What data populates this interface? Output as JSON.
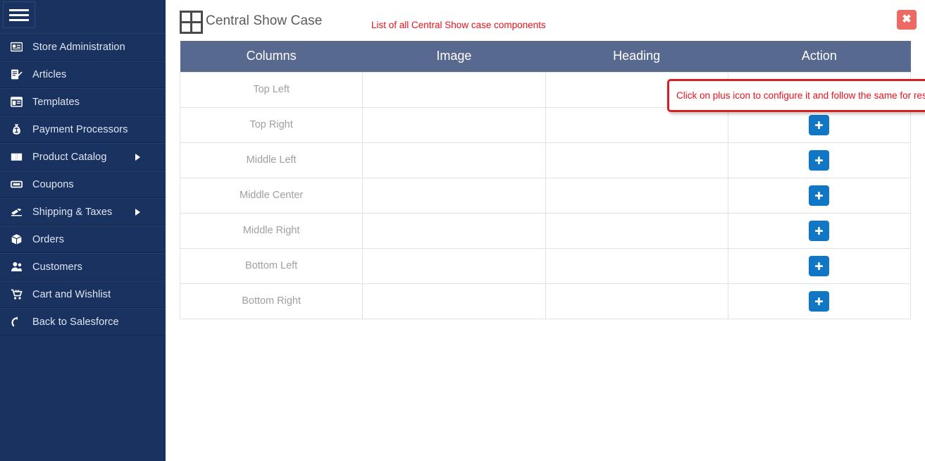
{
  "sidebar": {
    "menu_toggle": "hamburger-icon",
    "items": [
      {
        "label": "Store Administration",
        "icon": "id-card-icon",
        "has_submenu": false
      },
      {
        "label": "Articles",
        "icon": "article-edit-icon",
        "has_submenu": false
      },
      {
        "label": "Templates",
        "icon": "layout-template-icon",
        "has_submenu": false
      },
      {
        "label": "Payment Processors",
        "icon": "money-bag-icon",
        "has_submenu": false
      },
      {
        "label": "Product Catalog",
        "icon": "book-icon",
        "has_submenu": true
      },
      {
        "label": "Coupons",
        "icon": "ticket-icon",
        "has_submenu": false
      },
      {
        "label": "Shipping & Taxes",
        "icon": "shipping-truck-icon",
        "has_submenu": true
      },
      {
        "label": "Orders",
        "icon": "box-icon",
        "has_submenu": false
      },
      {
        "label": "Customers",
        "icon": "users-icon",
        "has_submenu": false
      },
      {
        "label": "Cart and Wishlist",
        "icon": "shopping-cart-icon",
        "has_submenu": false
      },
      {
        "label": "Back to Salesforce",
        "icon": "undo-arrow-icon",
        "has_submenu": false
      }
    ]
  },
  "header": {
    "title": "Central Show Case",
    "title_icon": "grid-2x2-icon",
    "note": "List of all Central Show case components",
    "close_label": "✖"
  },
  "table": {
    "columns": [
      "Columns",
      "Image",
      "Heading",
      "Action"
    ],
    "action_icon": "plus-icon",
    "rows": [
      {
        "columns": "Top Left",
        "image": "",
        "heading": ""
      },
      {
        "columns": "Top Right",
        "image": "",
        "heading": ""
      },
      {
        "columns": "Middle Left",
        "image": "",
        "heading": ""
      },
      {
        "columns": "Middle Center",
        "image": "",
        "heading": ""
      },
      {
        "columns": "Middle Right",
        "image": "",
        "heading": ""
      },
      {
        "columns": "Bottom Left",
        "image": "",
        "heading": ""
      },
      {
        "columns": "Bottom Right",
        "image": "",
        "heading": ""
      }
    ]
  },
  "callout": {
    "text": "Click on plus icon to configure it and follow the same for rest all"
  },
  "colors": {
    "sidebar_bg": "#1a3260",
    "table_header_bg": "#57698f",
    "plus_blue": "#1177c4",
    "close_red": "#ec6a63",
    "annotation_red": "#e8121c",
    "callout_border": "#d32027"
  }
}
